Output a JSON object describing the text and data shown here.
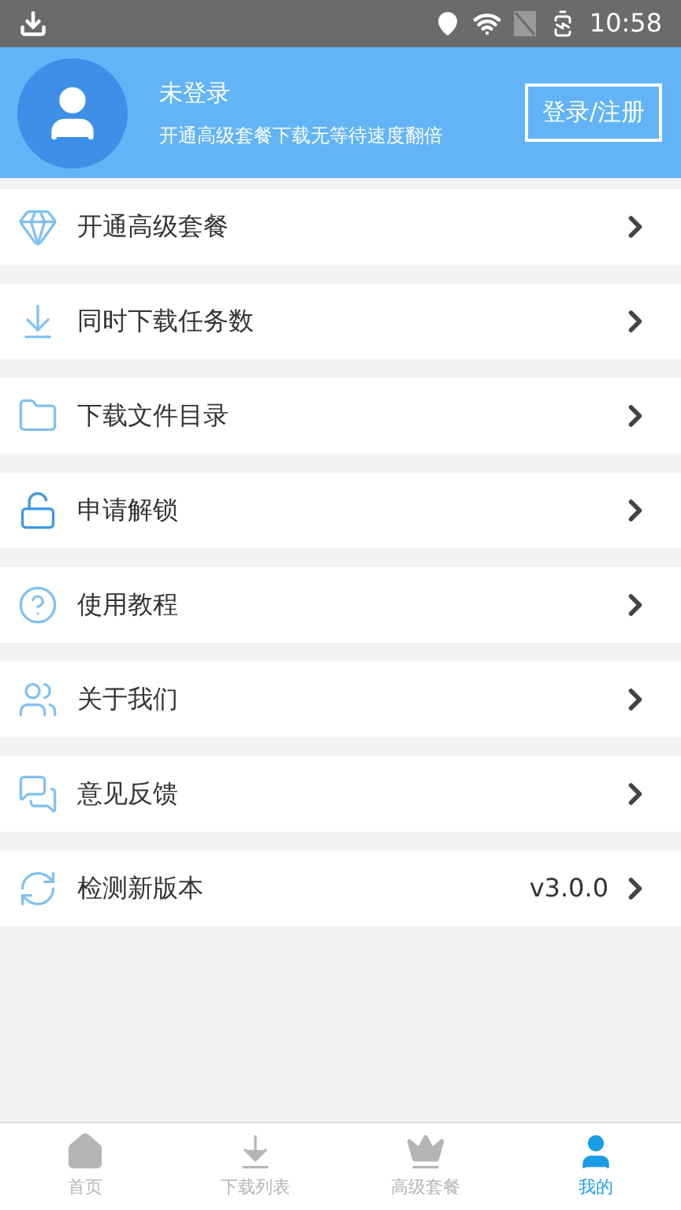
{
  "status_bar": {
    "time": "10:58"
  },
  "profile": {
    "name": "未登录",
    "subtitle": "开通高级套餐下载无等待速度翻倍",
    "login_button": "登录/注册"
  },
  "menu": [
    {
      "kind": "diamond",
      "label": "开通高级套餐"
    },
    {
      "kind": "download",
      "label": "同时下载任务数"
    },
    {
      "kind": "folder",
      "label": "下载文件目录"
    },
    {
      "kind": "unlock",
      "label": "申请解锁"
    },
    {
      "kind": "help",
      "label": "使用教程"
    },
    {
      "kind": "people",
      "label": "关于我们"
    },
    {
      "kind": "feedback",
      "label": "意见反馈"
    },
    {
      "kind": "update",
      "label": "检测新版本",
      "value": "v3.0.0"
    }
  ],
  "bottom_nav": [
    {
      "kind": "home",
      "label": "首页",
      "selected": false
    },
    {
      "kind": "download",
      "label": "下载列表",
      "selected": false
    },
    {
      "kind": "crown",
      "label": "高级套餐",
      "selected": false
    },
    {
      "kind": "user",
      "label": "我的",
      "selected": true
    }
  ]
}
